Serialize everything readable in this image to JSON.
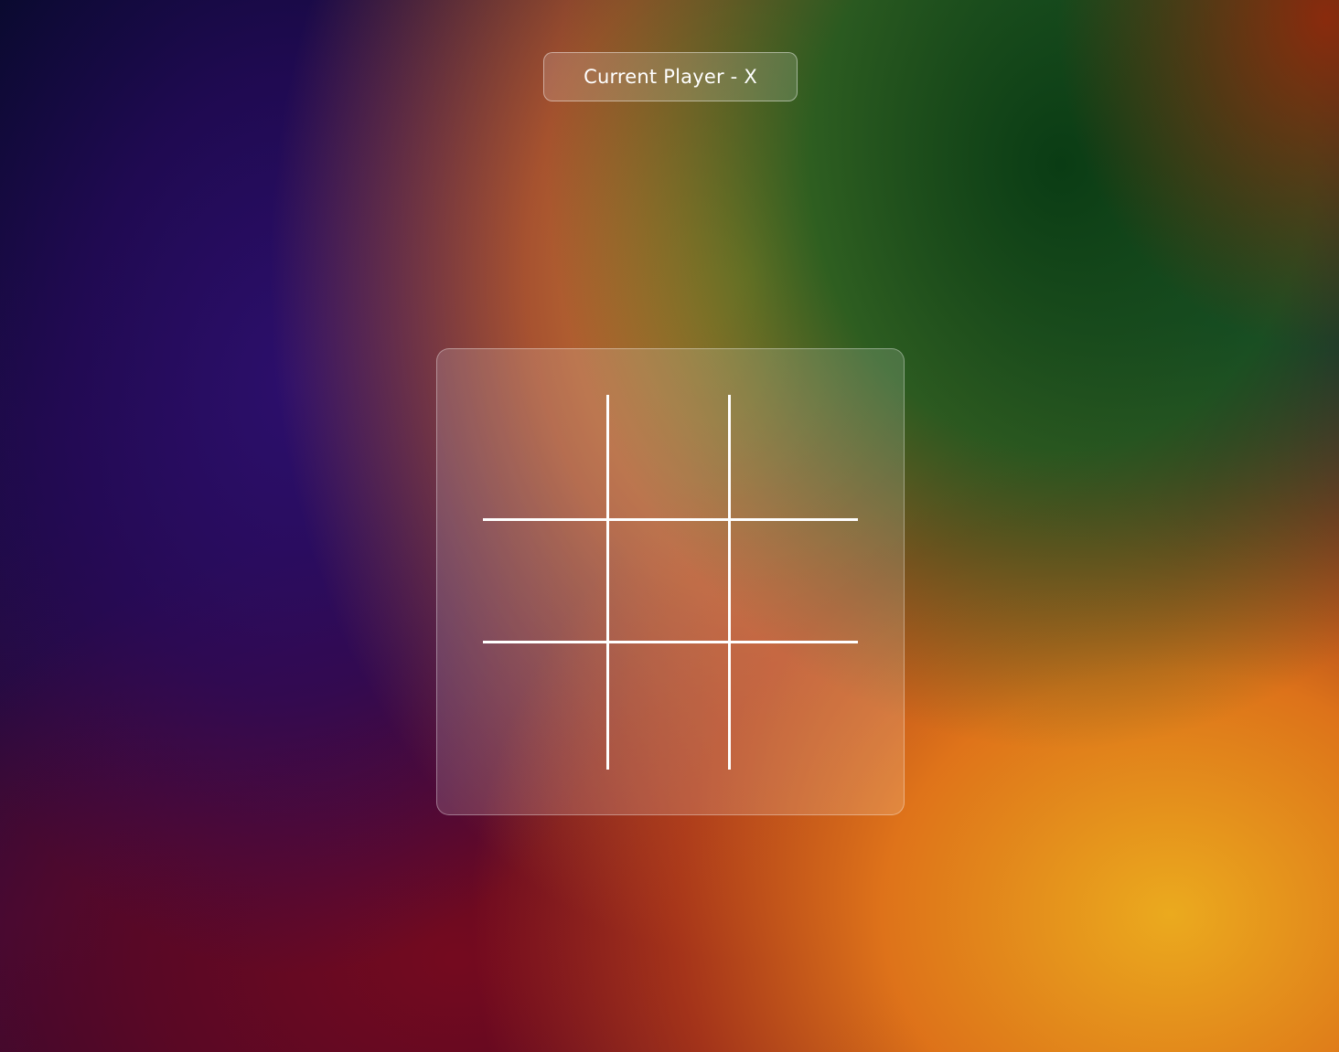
{
  "status": {
    "label": "Current Player - X"
  },
  "board": {
    "cells": [
      "",
      "",
      "",
      "",
      "",
      "",
      "",
      "",
      ""
    ]
  }
}
